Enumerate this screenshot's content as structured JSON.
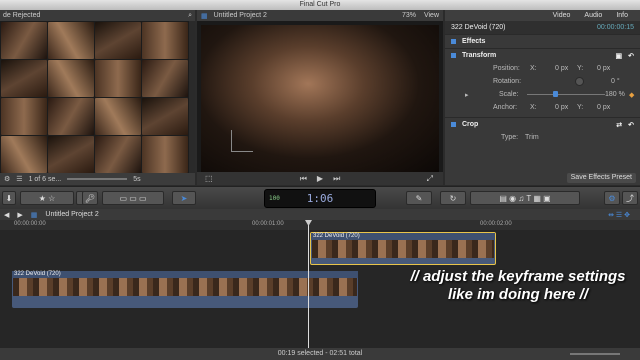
{
  "app_title": "Final Cut Pro",
  "browser": {
    "header_label": "de Rejected",
    "footer_count": "1 of 6 se...",
    "footer_duration": "5s"
  },
  "viewer": {
    "title": "Untitled Project 2",
    "zoom": "73%",
    "view_label": "View"
  },
  "inspector": {
    "tabs": [
      "Video",
      "Audio",
      "Info"
    ],
    "clip_name": "322 DeVoid (720)",
    "clip_timecode": "00:00:00:15",
    "sections": {
      "effects": "Effects",
      "transform": "Transform",
      "crop": "Crop"
    },
    "position": {
      "label": "Position:",
      "x_label": "X:",
      "x_value": "0 px",
      "y_label": "Y:",
      "y_value": "0 px"
    },
    "rotation": {
      "label": "Rotation:",
      "value": "0 °"
    },
    "scale": {
      "label": "Scale:",
      "value": "180 %"
    },
    "anchor": {
      "label": "Anchor:",
      "x_label": "X:",
      "x_value": "0 px",
      "y_label": "Y:",
      "y_value": "0 px"
    },
    "crop_type": {
      "label": "Type:",
      "value": "Trim"
    },
    "save_preset_label": "Save Effects Preset"
  },
  "toolbar": {
    "timecode_display": "1:06",
    "timecode_badge": "100"
  },
  "timeline": {
    "project_name": "Untitled Project 2",
    "ruler_marks": [
      "00:00:00:00",
      "00:00:01:00",
      "00:00:02:00"
    ],
    "clip_upper_label": "322 DeVoid (720)",
    "clip_lower_label": "322 DeVoid (720)"
  },
  "overlay_text": "// adjust the keyframe settings like im doing here //",
  "status": "00:19 selected - 02:51 total",
  "colors": {
    "accent": "#4a8ad8",
    "selection": "#e8c44a",
    "clip": "#47597a"
  }
}
